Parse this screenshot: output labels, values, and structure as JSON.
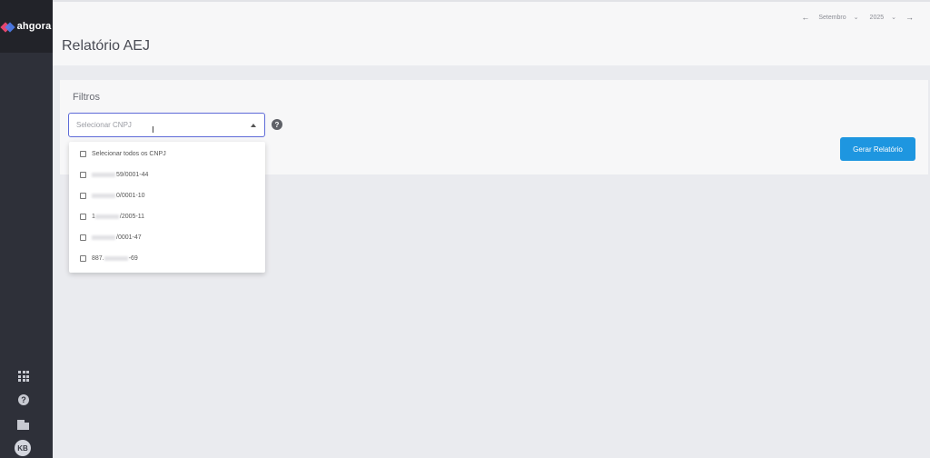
{
  "app": {
    "logo_text": "ahgora"
  },
  "header": {
    "title": "Relatório AEJ",
    "month": "Setembro",
    "year": "2025"
  },
  "filters": {
    "title": "Filtros",
    "cnpj_placeholder": "Selecionar CNPJ",
    "generate_button": "Gerar Relatório"
  },
  "dropdown": {
    "select_all": "Selecionar todos os CNPJ",
    "options": [
      {
        "visible_text": "59/0001-44"
      },
      {
        "visible_text": "0/0001-10"
      },
      {
        "prefix": "1",
        "visible_text": "/2005-11"
      },
      {
        "visible_text": "/0001-47"
      },
      {
        "prefix": "887.",
        "visible_text": "-69"
      }
    ]
  },
  "sidebar": {
    "avatar_initials": "KB"
  },
  "icons": {
    "prev": "arrow-left-icon",
    "next": "arrow-right-icon",
    "apps": "apps-grid-icon",
    "help": "help-icon",
    "company": "building-icon"
  },
  "colors": {
    "sidebar": "#2e3039",
    "primary_button": "#1e96e0",
    "select_border": "#5e6bd8"
  }
}
